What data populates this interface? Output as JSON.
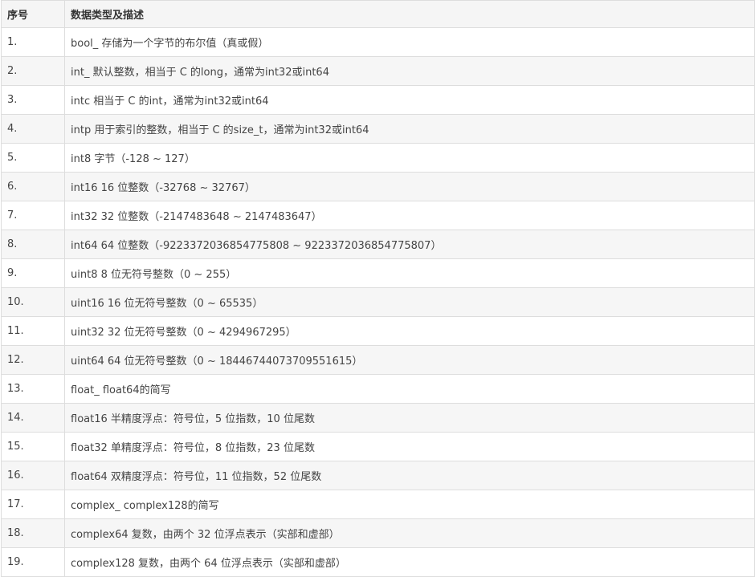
{
  "table": {
    "headers": [
      "序号",
      "数据类型及描述"
    ],
    "rows": [
      {
        "index": "1.",
        "description": "bool_ 存储为一个字节的布尔值（真或假）"
      },
      {
        "index": "2.",
        "description": "int_ 默认整数，相当于 C 的long，通常为int32或int64"
      },
      {
        "index": "3.",
        "description": "intc 相当于 C 的int，通常为int32或int64"
      },
      {
        "index": "4.",
        "description": "intp 用于索引的整数，相当于 C 的size_t，通常为int32或int64"
      },
      {
        "index": "5.",
        "description": "int8 字节（-128 ~ 127）"
      },
      {
        "index": "6.",
        "description": "int16 16 位整数（-32768 ~ 32767）"
      },
      {
        "index": "7.",
        "description": "int32 32 位整数（-2147483648 ~ 2147483647）"
      },
      {
        "index": "8.",
        "description": "int64 64 位整数（-9223372036854775808 ~ 9223372036854775807）"
      },
      {
        "index": "9.",
        "description": "uint8 8 位无符号整数（0 ~ 255）"
      },
      {
        "index": "10.",
        "description": "uint16 16 位无符号整数（0 ~ 65535）"
      },
      {
        "index": "11.",
        "description": "uint32 32 位无符号整数（0 ~ 4294967295）"
      },
      {
        "index": "12.",
        "description": "uint64 64 位无符号整数（0 ~ 18446744073709551615）"
      },
      {
        "index": "13.",
        "description": "float_ float64的简写"
      },
      {
        "index": "14.",
        "description": "float16 半精度浮点：符号位，5 位指数，10 位尾数"
      },
      {
        "index": "15.",
        "description": "float32 单精度浮点：符号位，8 位指数，23 位尾数"
      },
      {
        "index": "16.",
        "description": "float64 双精度浮点：符号位，11 位指数，52 位尾数"
      },
      {
        "index": "17.",
        "description": "complex_ complex128的简写"
      },
      {
        "index": "18.",
        "description": "complex64 复数，由两个 32 位浮点表示（实部和虚部）"
      },
      {
        "index": "19.",
        "description": "complex128 复数，由两个 64 位浮点表示（实部和虚部）"
      }
    ]
  }
}
